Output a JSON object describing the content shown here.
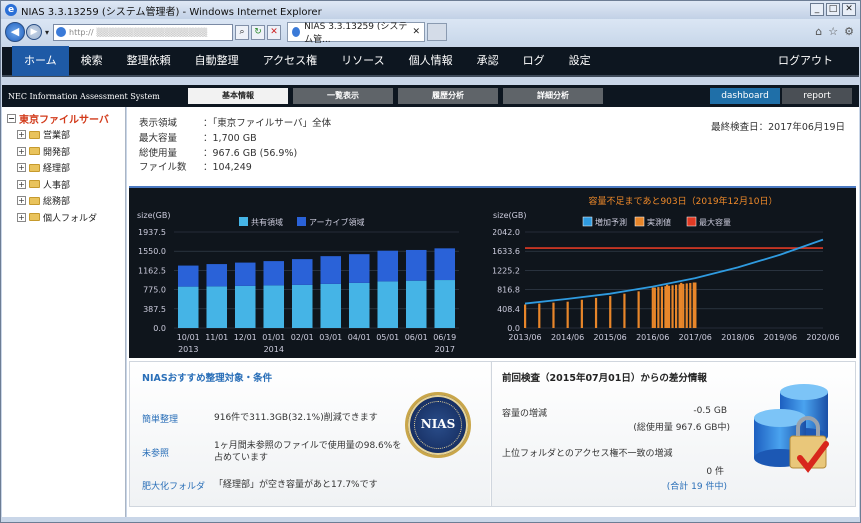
{
  "window": {
    "title": "NIAS 3.3.13259 (システム管理者) - Windows Internet Explorer",
    "tab_label": "NIAS 3.3.13259 (システム管...",
    "url_prefix": "http://"
  },
  "menu": {
    "items": [
      "ホーム",
      "検索",
      "整理依頼",
      "自動整理",
      "アクセス権",
      "リソース",
      "個人情報",
      "承認",
      "ログ",
      "設定"
    ],
    "active": "ホーム",
    "logout": "ログアウト"
  },
  "subnav": {
    "system_name": "NEC Information Assessment System",
    "tabs": [
      "基本情報",
      "一覧表示",
      "履歴分析",
      "詳細分析"
    ],
    "active_tab": "基本情報",
    "right_tabs": [
      "dashboard",
      "report"
    ]
  },
  "tree": {
    "root": "東京ファイルサーバ",
    "children": [
      "営業部",
      "開発部",
      "経理部",
      "人事部",
      "総務部",
      "個人フォルダ"
    ]
  },
  "info": {
    "scope_label": "表示領域",
    "scope_value": "：「東京ファイルサーバ」全体",
    "capacity_label": "最大容量",
    "capacity_value": "：1,700 GB",
    "used_label": "総使用量",
    "used_value": "：967.6 GB (56.9%)",
    "files_label": "ファイル数",
    "files_value": "：104,249",
    "last_check": "最終検査日：2017年06月19日"
  },
  "chart_data": [
    {
      "type": "bar",
      "ylabel": "size(GB)",
      "yticks": [
        "0.0",
        "387.5",
        "775.0",
        "1162.5",
        "1550.0",
        "1937.5"
      ],
      "ylim": [
        0,
        1937.5
      ],
      "categories": [
        "10/01",
        "11/01",
        "12/01",
        "01/01",
        "02/01",
        "03/01",
        "04/01",
        "05/01",
        "06/01",
        "06/19"
      ],
      "year_labels": [
        "2013",
        "2014",
        "2017"
      ],
      "legend_position": "top",
      "series": [
        {
          "name": "共有領域",
          "color": "#45b4e6",
          "values": [
            835,
            840,
            850,
            860,
            870,
            890,
            910,
            940,
            955,
            968
          ]
        },
        {
          "name": "アーカイブ領域",
          "color": "#2a62d8",
          "values": [
            425,
            450,
            470,
            490,
            520,
            560,
            580,
            620,
            620,
            640
          ]
        }
      ]
    },
    {
      "type": "line",
      "title": "容量不足まであと903日（2019年12月10日）",
      "ylabel": "size(GB)",
      "yticks": [
        "0.0",
        "408.4",
        "816.8",
        "1225.2",
        "1633.6",
        "2042.0"
      ],
      "ylim": [
        0,
        2042
      ],
      "xticks": [
        "2013/06",
        "2014/06",
        "2015/06",
        "2016/06",
        "2017/06",
        "2018/06",
        "2019/06",
        "2020/06"
      ],
      "legend_position": "top",
      "series": [
        {
          "name": "増加予測",
          "color": "#2f9be0",
          "x": [
            "2013/06",
            "2014/06",
            "2015/06",
            "2016/06",
            "2017/06",
            "2018/06",
            "2019/06",
            "2020/06"
          ],
          "values": [
            520,
            620,
            730,
            880,
            1060,
            1290,
            1560,
            1880
          ]
        },
        {
          "name": "実測値",
          "color": "#e8862a",
          "x": [
            "2013/06",
            "2013/10",
            "2014/02",
            "2014/06",
            "2014/10",
            "2015/02",
            "2015/06",
            "2015/10",
            "2016/02",
            "2016/06",
            "2016/10",
            "2017/02",
            "2017/06"
          ],
          "values": [
            500,
            520,
            540,
            560,
            600,
            640,
            680,
            730,
            780,
            860,
            920,
            960,
            968
          ]
        },
        {
          "name": "最大容量",
          "color": "#e03a24",
          "values": [
            1700
          ]
        }
      ]
    }
  ],
  "suggest": {
    "title": "NIASおすすめ整理対象・条件",
    "items": [
      {
        "link": "簡単整理",
        "text": "916件で311.3GB(32.1%)削減できます"
      },
      {
        "link": "未参照",
        "text": "1ヶ月間未参照のファイルで使用量の98.6%を占めています"
      },
      {
        "link": "肥大化フォルダ",
        "text": "「経理部」が空き容量があと17.7%です"
      }
    ],
    "seal_text": "NIAS",
    "seal_ring_text": "NEC Corporation"
  },
  "diff": {
    "title": "前回検査（2015年07月01日）からの差分情報",
    "cap_label": "容量の増減",
    "cap_value": "-0.5 GB",
    "cap_total": "(総使用量 967.6 GB中)",
    "access_label": "上位フォルダとのアクセス権不一致の増減",
    "access_value": "0 件",
    "access_total": "(合計 19 件中)"
  }
}
